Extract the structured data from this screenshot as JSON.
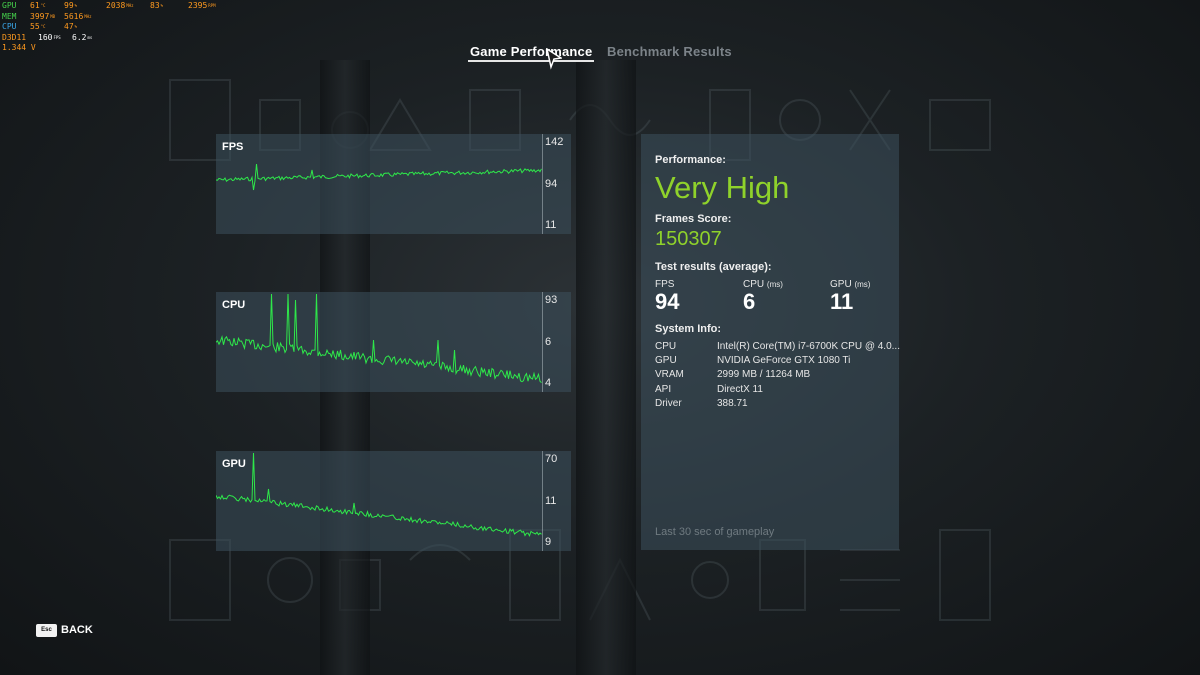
{
  "osd": {
    "rows": [
      {
        "label": "GPU",
        "label_color": "#45d04b",
        "cells": [
          {
            "value": "61",
            "unit": "°C",
            "color": "#ff9a1f"
          },
          {
            "value": "99",
            "unit": "%",
            "color": "#ff9a1f"
          },
          {
            "value": "2038",
            "unit": "MHz",
            "color": "#ff9a1f"
          },
          {
            "value": "83",
            "unit": "%",
            "color": "#ff9a1f"
          },
          {
            "value": "2395",
            "unit": "RPM",
            "color": "#ff9a1f"
          }
        ]
      },
      {
        "label": "MEM",
        "label_color": "#45d04b",
        "cells": [
          {
            "value": "3997",
            "unit": "MB",
            "color": "#ff9a1f"
          },
          {
            "value": "5616",
            "unit": "MHz",
            "color": "#ff9a1f"
          }
        ]
      },
      {
        "label": "CPU",
        "label_color": "#3aa6e8",
        "cells": [
          {
            "value": "55",
            "unit": "°C",
            "color": "#ff9a1f"
          },
          {
            "value": "47",
            "unit": "%",
            "color": "#ff9a1f"
          }
        ]
      },
      {
        "label": "D3D11",
        "label_color": "#ff9a1f",
        "cells": [
          {
            "value": "160",
            "unit": "FPS",
            "color": "#ffffff"
          },
          {
            "value": "6.2",
            "unit": "ms",
            "color": "#ffffff"
          }
        ]
      },
      {
        "label": "1.344 V",
        "label_color": "#ff9a1f",
        "cells": []
      }
    ]
  },
  "tabs": [
    {
      "label": "Game Performance",
      "active": true
    },
    {
      "label": "Benchmark Results",
      "active": false
    }
  ],
  "graphs": [
    {
      "label": "FPS",
      "ticks": [
        "142",
        "94",
        "11"
      ]
    },
    {
      "label": "CPU",
      "ticks": [
        "93",
        "6",
        "4"
      ]
    },
    {
      "label": "GPU",
      "ticks": [
        "70",
        "11",
        "9"
      ]
    }
  ],
  "performance": {
    "title": "Performance:",
    "rating": "Very High",
    "frames_score_label": "Frames Score:",
    "frames_score": "150307",
    "test_results_label": "Test results (average):",
    "stats": [
      {
        "label": "FPS",
        "unit": "",
        "value": "94"
      },
      {
        "label": "CPU",
        "unit": "(ms)",
        "value": "6"
      },
      {
        "label": "GPU",
        "unit": "(ms)",
        "value": "11"
      }
    ],
    "system_info_label": "System Info:",
    "system_info": [
      {
        "key": "CPU",
        "value": "Intel(R) Core(TM) i7-6700K CPU @ 4.0..."
      },
      {
        "key": "GPU",
        "value": "NVIDIA GeForce GTX 1080 Ti"
      },
      {
        "key": "VRAM",
        "value": "2999 MB / 11264 MB"
      },
      {
        "key": "API",
        "value": "DirectX 11"
      },
      {
        "key": "Driver",
        "value": "388.71"
      }
    ],
    "footnote": "Last 30 sec of gameplay"
  },
  "back": {
    "key": "Esc",
    "label": "BACK"
  },
  "colors": {
    "accent_green": "#8fd22b",
    "line_green": "#2ee84a",
    "panel": "#3c505c"
  }
}
